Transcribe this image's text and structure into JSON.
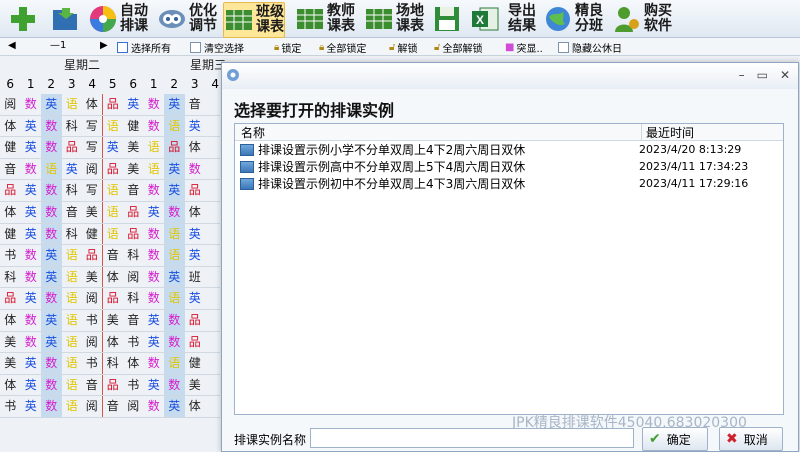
{
  "toolbar": {
    "auto_schedule": "自动\n排课",
    "optimize": "优化\n调节",
    "class_timetable": "班级\n课表",
    "teacher_timetable": "教师\n课表",
    "venue_timetable": "场地\n课表",
    "export_results": "导出\n结果",
    "fine_split": "精良\n分班",
    "buy_software": "购买\n软件"
  },
  "toolbar2": {
    "week_indicator": "—1",
    "select_all": "选择所有",
    "clear_selection": "清空选择",
    "lock": "锁定",
    "lock_all": "全部锁定",
    "unlock": "解锁",
    "unlock_all": "全部解锁",
    "highlight": "突显..",
    "hide_holidays": "隐藏公休日"
  },
  "grid": {
    "day_label": "星期二",
    "day_label2": "星期三",
    "period_headers": [
      "6",
      "1",
      "2",
      "3",
      "4",
      "5",
      "6",
      "1",
      "2",
      "3",
      "4"
    ],
    "rows": [
      [
        "阅",
        "数",
        "英",
        "语",
        "体",
        "品",
        "英",
        "数",
        "英",
        "音"
      ],
      [
        "体",
        "英",
        "数",
        "科",
        "写",
        "语",
        "健",
        "数",
        "语",
        "英"
      ],
      [
        "健",
        "英",
        "数",
        "品",
        "写",
        "英",
        "美",
        "语",
        "品",
        "体"
      ],
      [
        "音",
        "数",
        "语",
        "英",
        "阅",
        "品",
        "美",
        "语",
        "英",
        "数"
      ],
      [
        "品",
        "英",
        "数",
        "科",
        "写",
        "语",
        "音",
        "数",
        "英",
        "品"
      ],
      [
        "体",
        "英",
        "数",
        "音",
        "美",
        "语",
        "品",
        "英",
        "数",
        "体"
      ],
      [
        "健",
        "英",
        "数",
        "科",
        "健",
        "语",
        "品",
        "数",
        "语",
        "英"
      ],
      [
        "书",
        "数",
        "英",
        "语",
        "品",
        "音",
        "科",
        "数",
        "语",
        "英"
      ],
      [
        "科",
        "数",
        "英",
        "语",
        "美",
        "体",
        "阅",
        "数",
        "英",
        "班"
      ],
      [
        "品",
        "英",
        "数",
        "语",
        "阅",
        "品",
        "科",
        "数",
        "语",
        "英"
      ],
      [
        "体",
        "数",
        "英",
        "语",
        "书",
        "美",
        "音",
        "英",
        "数",
        "品"
      ],
      [
        "美",
        "数",
        "英",
        "语",
        "阅",
        "体",
        "书",
        "英",
        "数",
        "品"
      ],
      [
        "美",
        "英",
        "数",
        "语",
        "书",
        "科",
        "体",
        "数",
        "语",
        "健"
      ],
      [
        "体",
        "英",
        "数",
        "语",
        "音",
        "品",
        "书",
        "英",
        "数",
        "美"
      ],
      [
        "书",
        "英",
        "数",
        "语",
        "阅",
        "音",
        "阅",
        "数",
        "英",
        "体"
      ]
    ]
  },
  "dialog": {
    "heading": "选择要打开的排课实例",
    "col_name": "名称",
    "col_time": "最近时间",
    "items": [
      {
        "name": "排课设置示例小学不分单双周上4下2周六周日双休",
        "time": "2023/4/20 8:13:29"
      },
      {
        "name": "排课设置示例高中不分单双周上5下4周六周日双休",
        "time": "2023/4/11 17:34:23"
      },
      {
        "name": "排课设置示例初中不分单双周上4下3周六周日双休",
        "time": "2023/4/11 17:29:16"
      }
    ],
    "name_label": "排课实例名称",
    "watermark": "JPK精良排课软件45040.683020300",
    "ok": "确定",
    "cancel": "取消"
  }
}
